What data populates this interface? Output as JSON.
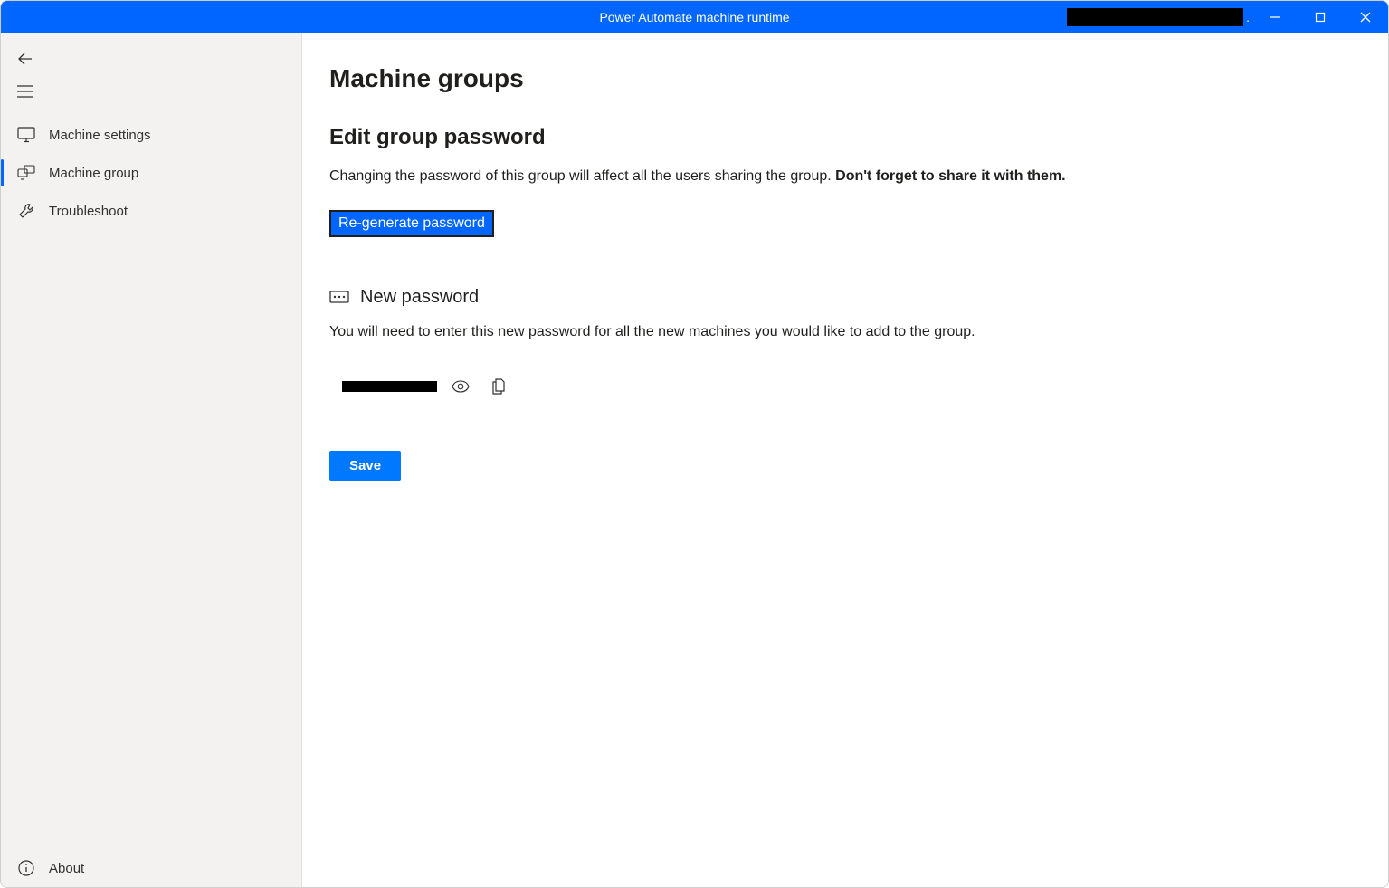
{
  "titlebar": {
    "title": "Power Automate machine runtime"
  },
  "sidebar": {
    "items": [
      {
        "label": "Machine settings"
      },
      {
        "label": "Machine group"
      },
      {
        "label": "Troubleshoot"
      }
    ],
    "about": "About"
  },
  "main": {
    "page_title": "Machine groups",
    "section_title": "Edit group password",
    "description_prefix": "Changing the password of this group will affect all the users sharing the group. ",
    "description_bold": "Don't forget to share it with them.",
    "regenerate_label": "Re-generate password",
    "new_password_label": "New password",
    "new_password_desc": "You will need to enter this new password for all the new machines you would like to add to the group.",
    "save_label": "Save"
  }
}
